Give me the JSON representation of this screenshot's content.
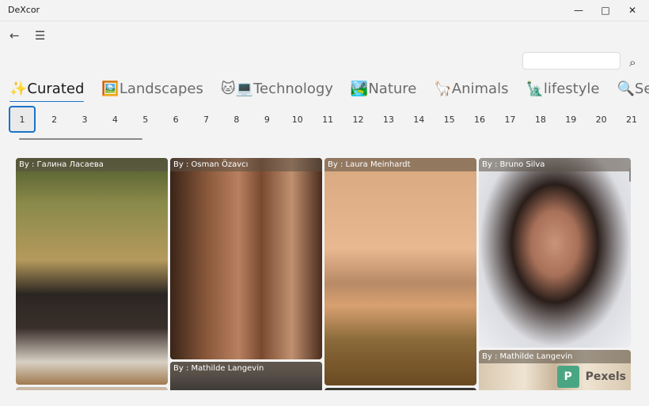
{
  "window": {
    "title": "DeXcor",
    "minimize_icon": "minimize-icon",
    "maximize_icon": "maximize-icon",
    "close_icon": "close-icon"
  },
  "nav": {
    "back_icon": "back-arrow-icon",
    "menu_icon": "hamburger-menu-icon"
  },
  "search": {
    "value": "",
    "placeholder": "",
    "icon": "search-icon"
  },
  "tabs": [
    {
      "emoji": "✨",
      "label": "Curated",
      "active": true
    },
    {
      "emoji": "🖼️",
      "label": "Landscapes"
    },
    {
      "emoji": "🐱💻",
      "label": "Technology"
    },
    {
      "emoji": "🏞️",
      "label": "Nature"
    },
    {
      "emoji": "🦙",
      "label": "Animals"
    },
    {
      "emoji": "🗽",
      "label": "lifestyle"
    },
    {
      "emoji": "🔍",
      "label": "Search"
    }
  ],
  "pages": [
    "1",
    "2",
    "3",
    "4",
    "5",
    "6",
    "7",
    "8",
    "9",
    "10",
    "11",
    "12",
    "13",
    "14",
    "15",
    "16",
    "17",
    "18",
    "19",
    "20",
    "21"
  ],
  "active_page": "1",
  "photos": [
    {
      "author": "By : Галина Ласаева"
    },
    {
      "author": "By : Osman Özavcı"
    },
    {
      "author": "By : Laura Meinhardt"
    },
    {
      "author": "By : Bruno Silva"
    },
    {
      "author": "By : Mathilde Langevin"
    },
    {
      "author": "By : Mathilde Langevin"
    }
  ],
  "pexels": {
    "label": "Pexels",
    "logo": "P"
  }
}
